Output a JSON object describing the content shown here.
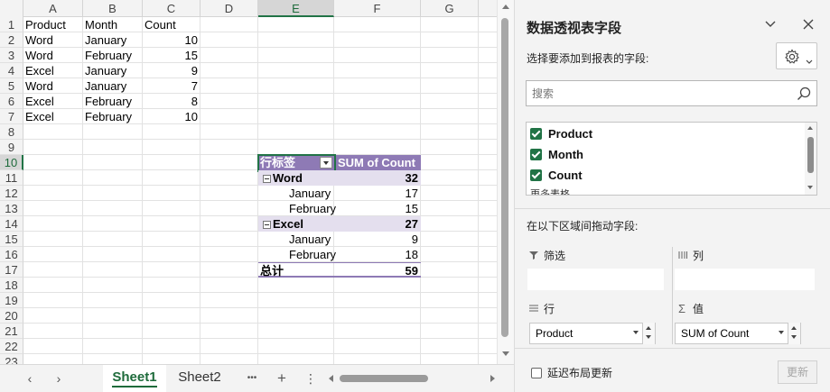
{
  "sheet": {
    "columns": [
      "A",
      "B",
      "C",
      "D",
      "E",
      "F",
      "G"
    ],
    "rows": [
      "1",
      "2",
      "3",
      "4",
      "5",
      "6",
      "7",
      "8",
      "9",
      "10",
      "11",
      "12",
      "13",
      "14",
      "15",
      "16",
      "17",
      "18",
      "19",
      "20",
      "21",
      "22",
      "23"
    ],
    "headers": [
      "Product",
      "Month",
      "Count"
    ],
    "data": [
      [
        "Word",
        "January",
        "10"
      ],
      [
        "Word",
        "February",
        "15"
      ],
      [
        "Excel",
        "January",
        "9"
      ],
      [
        "Word",
        "January",
        "7"
      ],
      [
        "Excel",
        "February",
        "8"
      ],
      [
        "Excel",
        "February",
        "10"
      ]
    ],
    "selected_column": "E",
    "selected_row": "10"
  },
  "pivot": {
    "row_label_header": "行标签",
    "value_header": "SUM of Count",
    "groups": [
      {
        "name": "Word",
        "total": "32",
        "items": [
          {
            "label": "January",
            "value": "17"
          },
          {
            "label": "February",
            "value": "15"
          }
        ]
      },
      {
        "name": "Excel",
        "total": "27",
        "items": [
          {
            "label": "January",
            "value": "9"
          },
          {
            "label": "February",
            "value": "18"
          }
        ]
      }
    ],
    "grand_total_label": "总计",
    "grand_total_value": "59"
  },
  "tabs": {
    "sheets": [
      "Sheet1",
      "Sheet2"
    ],
    "active": "Sheet1",
    "more": "•••",
    "add": "+",
    "options": "⋮",
    "prev": "‹",
    "next": "›"
  },
  "pane": {
    "title": "数据透视表字段",
    "choose_label": "选择要添加到报表的字段:",
    "search_placeholder": "搜索",
    "fields": [
      "Product",
      "Month",
      "Count"
    ],
    "more_tables": "更多表格...",
    "drag_label": "在以下区域间拖动字段:",
    "areas": {
      "filters": "筛选",
      "columns": "列",
      "rows": "行",
      "values": "值"
    },
    "rows_field": "Product",
    "values_field": "SUM of Count",
    "defer_label": "延迟布局更新",
    "update_label": "更新",
    "icons": [
      "chevron-down-icon",
      "close-icon",
      "gear-icon",
      "search-icon",
      "filter-icon",
      "columns-icon",
      "rows-icon",
      "sigma-icon"
    ]
  },
  "colors": {
    "accent": "#217346",
    "pivot_header": "#8e7ab5",
    "pivot_group": "#e4dfee"
  }
}
